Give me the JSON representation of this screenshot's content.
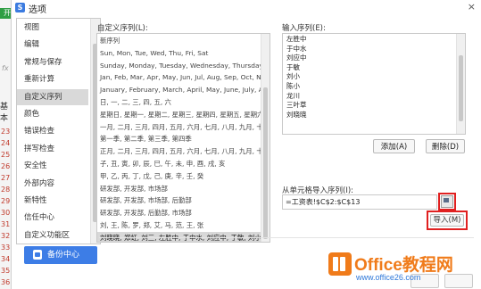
{
  "background": {
    "tag": "开",
    "fx": "fx",
    "base": "基本",
    "row_numbers": [
      "23",
      "24",
      "25",
      "26",
      "27",
      "28",
      "29",
      "30",
      "31",
      "32",
      "33",
      "34",
      "35",
      "36"
    ]
  },
  "dialog": {
    "title": "选项",
    "close": "×",
    "nav": [
      "视图",
      "编辑",
      "常规与保存",
      "重新计算",
      "自定义序列",
      "颜色",
      "错误检查",
      "拼写检查",
      "安全性",
      "外部内容",
      "新特性",
      "信任中心",
      "自定义功能区"
    ],
    "nav_active": 4,
    "backup_label": "备份中心",
    "custom_list_label": "自定义序列(L):",
    "entries_label": "输入序列(E):",
    "custom_lists": [
      "新序列",
      "Sun, Mon, Tue, Wed, Thu, Fri, Sat",
      "Sunday, Monday, Tuesday, Wednesday, Thursday, Fri",
      "Jan, Feb, Mar, Apr, May, Jun, Jul, Aug, Sep, Oct, Nov",
      "January, February, March, April, May, June, July, Au",
      "日, 一, 二, 三, 四, 五, 六",
      "星期日, 星期一, 星期二, 星期三, 星期四, 星期五, 星期六",
      "一月, 二月, 三月, 四月, 五月, 六月, 七月, 八月, 九月, 十月,",
      "第一季, 第二季, 第三季, 第四季",
      "正月, 二月, 三月, 四月, 五月, 六月, 七月, 八月, 九月, 十月,",
      "子, 丑, 寅, 卯, 辰, 巳, 午, 未, 申, 酉, 戌, 亥",
      "甲, 乙, 丙, 丁, 戊, 己, 庚, 辛, 壬, 癸",
      "研发部, 开发部, 市场部",
      "研发部, 开发部, 市场部, 后勤部",
      "研发部, 开发部, 后勤部, 市场部",
      "刘, 王, 陈, 罗, 郑, 艾, 马, 范, 王, 张",
      "刘晓晓, 郑虹, 刘三, 左胜中, 于中水, 刘应中, 于敏, 刘小, 陈"
    ],
    "selected_list": 16,
    "entries": [
      "左胜中",
      "于中水",
      "刘应中",
      "于敏",
      "刘小",
      "陈小",
      "龙川",
      "三叶草",
      "刘晓晓"
    ],
    "add_label": "添加(A)",
    "delete_label": "删除(D)",
    "import_from_label": "从单元格导入序列(I):",
    "import_range": "=工资表!$C$2:$C$13",
    "import_label": "导入(M)"
  },
  "watermark": {
    "title": "Office教程网",
    "url": "www.office26.com"
  },
  "colors": {
    "accent_blue": "#3d7de6",
    "highlight_red": "#e02020",
    "watermark_orange": "#f07b1a"
  }
}
